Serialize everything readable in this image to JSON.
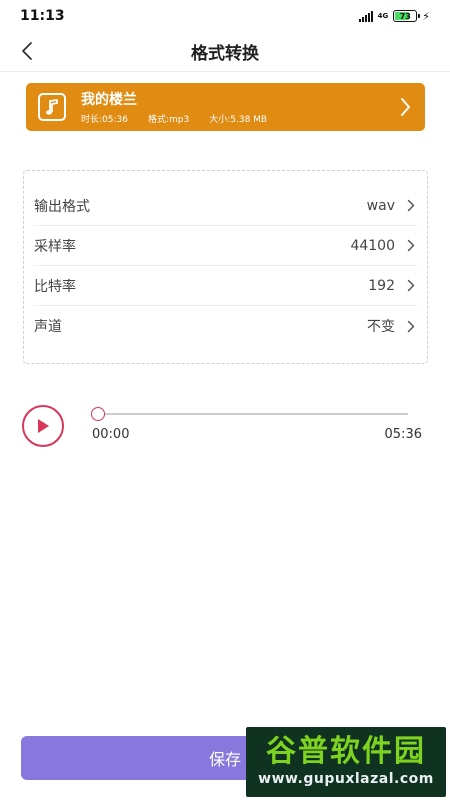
{
  "status_bar": {
    "time": "11:13",
    "network": "4G",
    "battery": "73",
    "battery_level": 0.73
  },
  "header": {
    "title": "格式转换",
    "back_icon": "chevron-left-icon"
  },
  "song": {
    "name": "我的楼兰",
    "duration": "时长:05:36",
    "format": "格式:mp3",
    "size": "大小:5.38 MB",
    "card_color": "#e08b12",
    "icon": "music-note-icon"
  },
  "settings": [
    {
      "label": "输出格式",
      "value": "wav"
    },
    {
      "label": "采样率",
      "value": "44100"
    },
    {
      "label": "比特率",
      "value": "192"
    },
    {
      "label": "声道",
      "value": "不变"
    }
  ],
  "player": {
    "current_time": "00:00",
    "total_time": "05:36",
    "progress": 0,
    "accent_color": "#d9365a"
  },
  "actions": {
    "save_label": "保存",
    "save_color": "#8877dd"
  },
  "watermark": {
    "main": "谷普软件园",
    "url": "www.gupuxlazal.com"
  }
}
